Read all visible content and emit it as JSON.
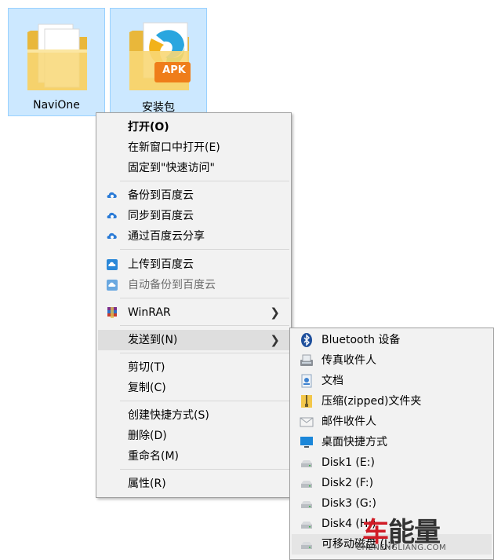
{
  "desktop": {
    "items": [
      {
        "label": "NaviOne"
      },
      {
        "label": "安装包",
        "badge": "APK"
      }
    ]
  },
  "context_menu": {
    "items": {
      "open": "打开(O)",
      "open_new_window": "在新窗口中打开(E)",
      "pin_quick_access": "固定到\"快速访问\"",
      "backup_baidu": "备份到百度云",
      "sync_baidu": "同步到百度云",
      "share_baidu": "通过百度云分享",
      "upload_baidu": "上传到百度云",
      "auto_backup_baidu": "自动备份到百度云",
      "winrar": "WinRAR",
      "send_to": "发送到(N)",
      "cut": "剪切(T)",
      "copy": "复制(C)",
      "create_shortcut": "创建快捷方式(S)",
      "delete": "删除(D)",
      "rename": "重命名(M)",
      "properties": "属性(R)"
    }
  },
  "send_to_menu": {
    "items": {
      "bluetooth": "Bluetooth 设备",
      "fax": "传真收件人",
      "documents": "文档",
      "zip": "压缩(zipped)文件夹",
      "mail": "邮件收件人",
      "desktop_shortcut": "桌面快捷方式",
      "disk1": "Disk1 (E:)",
      "disk2": "Disk2 (F:)",
      "disk3": "Disk3 (G:)",
      "disk4": "Disk4 (H:)",
      "removable": "可移动磁盘 (J:)"
    }
  },
  "watermark": {
    "brand_char1": "车",
    "brand_rest": "能量",
    "site": "CHENENGLIANG.COM"
  },
  "colors": {
    "selection_bg": "#cce8ff",
    "selection_border": "#99d1ff",
    "menu_bg": "#f2f2f2",
    "menu_highlight": "#dedede",
    "folder_yellow": "#f5c94c",
    "watermark_red": "#d01c26"
  }
}
